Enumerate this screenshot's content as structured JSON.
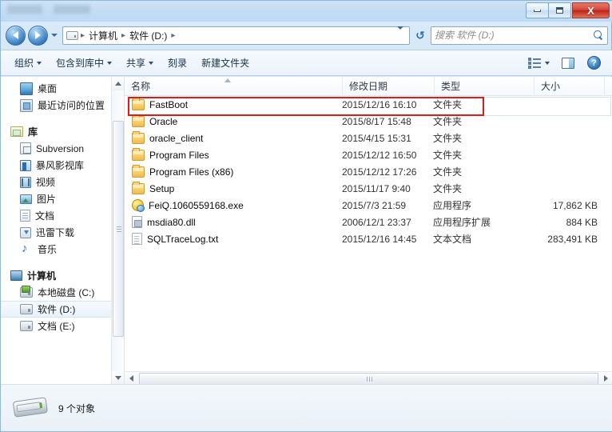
{
  "window": {
    "controls": {
      "minimize_label": "–",
      "maximize_label": "□",
      "close_label": "X"
    }
  },
  "nav": {
    "back_icon": "back-arrow-icon",
    "forward_icon": "forward-arrow-icon",
    "recent_icon": "chevron-down-icon",
    "breadcrumb": {
      "drive_icon": "drive-icon",
      "separator": "▸",
      "items": [
        {
          "label": "计算机"
        },
        {
          "label": "软件 (D:)"
        }
      ]
    },
    "address_dropdown_icon": "chevron-down-icon",
    "refresh_label": "↺",
    "search": {
      "placeholder": "搜索 软件 (D:)",
      "value": "",
      "icon": "search-icon"
    }
  },
  "toolbar": {
    "items": [
      {
        "label": "组织",
        "has_caret": true
      },
      {
        "label": "包含到库中",
        "has_caret": true
      },
      {
        "label": "共享",
        "has_caret": true
      },
      {
        "label": "刻录",
        "has_caret": false
      },
      {
        "label": "新建文件夹",
        "has_caret": false
      }
    ],
    "view_icon": "view-options-icon",
    "view_caret_icon": "chevron-down-icon",
    "preview_pane_icon": "preview-pane-icon",
    "help_icon": "help-icon",
    "help_label": "?"
  },
  "sidebar": {
    "items": [
      {
        "label": "桌面",
        "icon": "desktop-icon",
        "type": "item",
        "selected": false
      },
      {
        "label": "最近访问的位置",
        "icon": "recent-places-icon",
        "type": "item",
        "selected": false
      },
      {
        "label": "库",
        "icon": "library-icon",
        "type": "group",
        "selected": false
      },
      {
        "label": "Subversion",
        "icon": "subversion-icon",
        "type": "item",
        "selected": false
      },
      {
        "label": "暴风影视库",
        "icon": "storm-media-icon",
        "type": "item",
        "selected": false
      },
      {
        "label": "视频",
        "icon": "videos-icon",
        "type": "item",
        "selected": false
      },
      {
        "label": "图片",
        "icon": "pictures-icon",
        "type": "item",
        "selected": false
      },
      {
        "label": "文档",
        "icon": "documents-icon",
        "type": "item",
        "selected": false
      },
      {
        "label": "迅雷下载",
        "icon": "thunder-download-icon",
        "type": "item",
        "selected": false
      },
      {
        "label": "音乐",
        "icon": "music-icon",
        "type": "item",
        "selected": false
      },
      {
        "label": "计算机",
        "icon": "computer-icon",
        "type": "group",
        "selected": false
      },
      {
        "label": "本地磁盘 (C:)",
        "icon": "system-drive-icon",
        "type": "item",
        "selected": false
      },
      {
        "label": "软件 (D:)",
        "icon": "drive-icon",
        "type": "item",
        "selected": true
      },
      {
        "label": "文档 (E:)",
        "icon": "drive-icon",
        "type": "item",
        "selected": false
      }
    ]
  },
  "filelist": {
    "columns": [
      {
        "label": "名称",
        "sorted": true
      },
      {
        "label": "修改日期",
        "sorted": false
      },
      {
        "label": "类型",
        "sorted": false
      },
      {
        "label": "大小",
        "sorted": false
      }
    ],
    "sort_indicator_icon": "sort-ascending-icon",
    "rows": [
      {
        "name": "FastBoot",
        "date": "2015/12/16 16:10",
        "type": "文件夹",
        "size": "",
        "icon": "folder-icon",
        "highlighted": true
      },
      {
        "name": "Oracle",
        "date": "2015/8/17 15:48",
        "type": "文件夹",
        "size": "",
        "icon": "folder-icon",
        "highlighted": false
      },
      {
        "name": "oracle_client",
        "date": "2015/4/15 15:31",
        "type": "文件夹",
        "size": "",
        "icon": "folder-icon",
        "highlighted": false
      },
      {
        "name": "Program Files",
        "date": "2015/12/12 16:50",
        "type": "文件夹",
        "size": "",
        "icon": "folder-icon",
        "highlighted": false
      },
      {
        "name": "Program Files (x86)",
        "date": "2015/12/12 17:26",
        "type": "文件夹",
        "size": "",
        "icon": "folder-icon",
        "highlighted": false
      },
      {
        "name": "Setup",
        "date": "2015/11/17 9:40",
        "type": "文件夹",
        "size": "",
        "icon": "folder-icon",
        "highlighted": false
      },
      {
        "name": "FeiQ.1060559168.exe",
        "date": "2015/7/3 21:59",
        "type": "应用程序",
        "size": "17,862 KB",
        "icon": "application-icon",
        "highlighted": false
      },
      {
        "name": "msdia80.dll",
        "date": "2006/12/1 23:37",
        "type": "应用程序扩展",
        "size": "884 KB",
        "icon": "dll-icon",
        "highlighted": false
      },
      {
        "name": "SQLTraceLog.txt",
        "date": "2015/12/16 14:45",
        "type": "文本文档",
        "size": "283,491 KB",
        "icon": "text-file-icon",
        "highlighted": false
      }
    ],
    "highlight_color": "#e01b1b"
  },
  "statusbar": {
    "drive_icon": "drive-icon",
    "text": "9 个对象"
  }
}
